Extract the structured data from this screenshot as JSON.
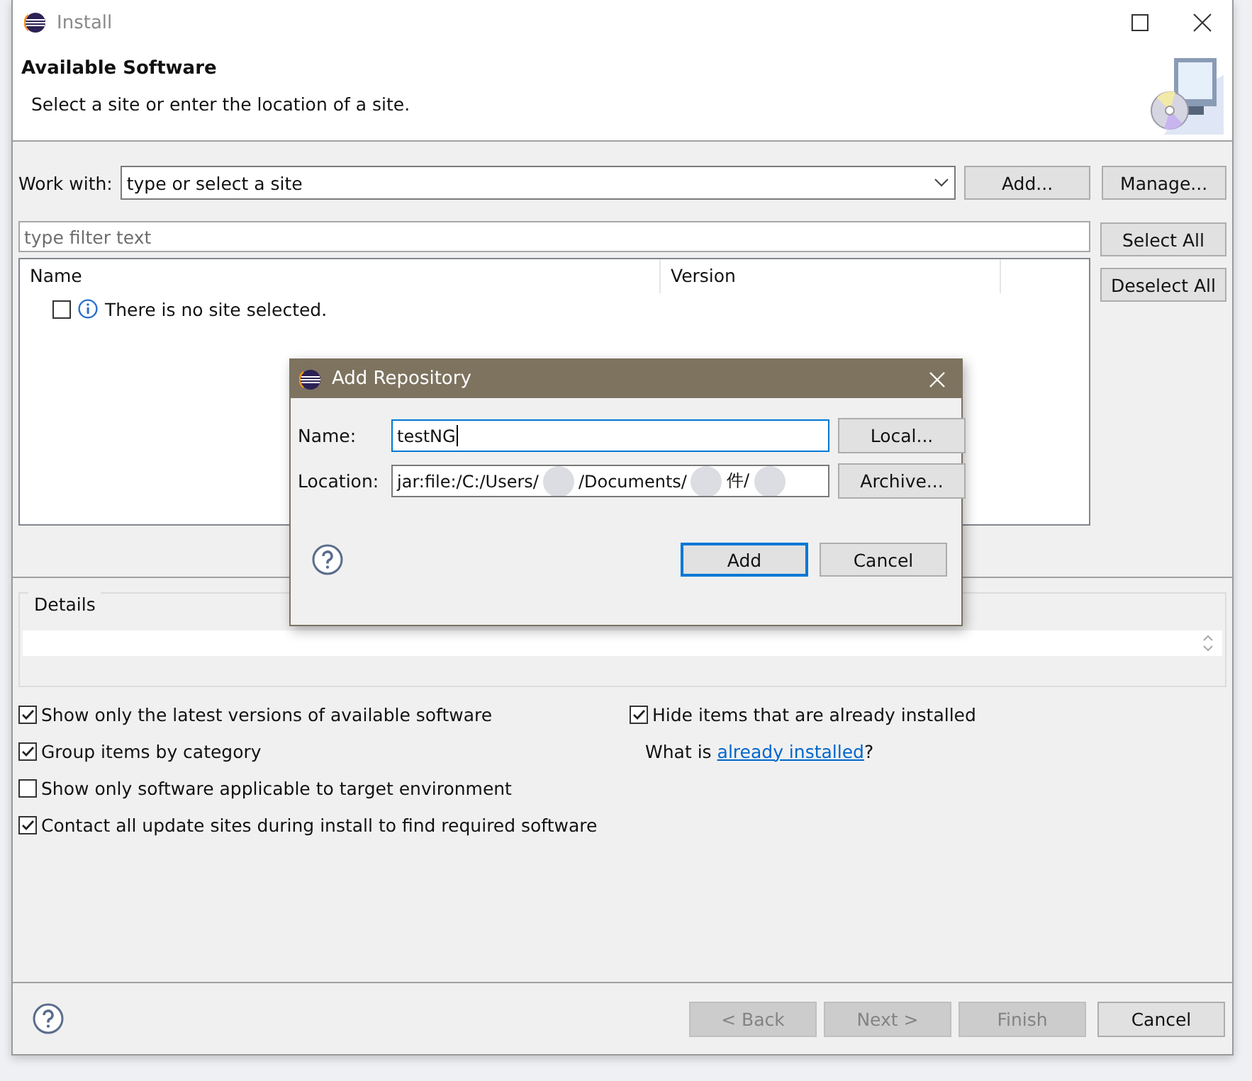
{
  "window": {
    "title": "Install"
  },
  "header": {
    "title": "Available Software",
    "subtitle": "Select a site or enter the location of a site."
  },
  "work_with": {
    "label": "Work with:",
    "placeholder": "type or select a site",
    "buttons": [
      "Add...",
      "Manage..."
    ]
  },
  "filter": {
    "placeholder": "type filter text"
  },
  "side_buttons": [
    "Select All",
    "Deselect All"
  ],
  "table": {
    "columns": [
      "Name",
      "Version"
    ],
    "rows": [
      {
        "checked": false,
        "text": "There is no site selected."
      }
    ]
  },
  "details": {
    "title": "Details"
  },
  "options_left": [
    {
      "label": "Show only the latest versions of available software",
      "checked": true
    },
    {
      "label": "Group items by category",
      "checked": true
    },
    {
      "label": "Show only software applicable to target environment",
      "checked": false
    },
    {
      "label": "Contact all update sites during install to find required software",
      "checked": true
    }
  ],
  "options_right": [
    {
      "kind": "checkbox",
      "label": "Hide items that are already installed",
      "checked": true
    },
    {
      "kind": "link_text",
      "prefix": "What is ",
      "link": "already installed",
      "suffix": "?"
    }
  ],
  "footer_buttons": [
    {
      "label": "< Back",
      "disabled": true
    },
    {
      "label": "Next >",
      "disabled": true
    },
    {
      "label": "Finish",
      "disabled": true
    },
    {
      "label": "Cancel",
      "disabled": false
    }
  ],
  "dialog": {
    "title": "Add Repository",
    "fields": [
      {
        "label": "Name:",
        "segments": [
          "testNG"
        ],
        "focused": true,
        "button": "Local..."
      },
      {
        "label": "Location:",
        "segments": [
          "jar:file:/C:/Users/",
          "/Documents/",
          "件/"
        ],
        "focused": false,
        "button": "Archive..."
      }
    ],
    "buttons": [
      {
        "label": "Add",
        "default": true
      },
      {
        "label": "Cancel",
        "default": false
      }
    ]
  }
}
